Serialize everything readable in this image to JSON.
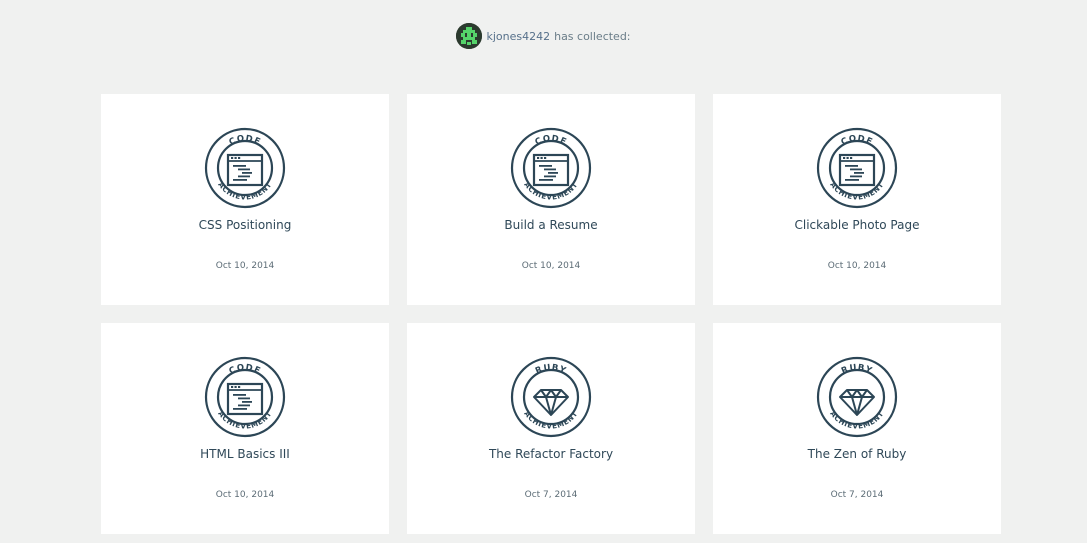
{
  "profile": {
    "username": "kjones4242",
    "collected_text": "has collected:"
  },
  "colors": {
    "badge": "#2c4656",
    "avatar_green": "#55d46a",
    "background": "#f0f1f0"
  },
  "achievements": [
    {
      "badge_top": "CODE",
      "badge_bottom": "ACHIEVEMENT",
      "icon": "code-window-icon",
      "title": "CSS Positioning",
      "date": "Oct 10, 2014"
    },
    {
      "badge_top": "CODE",
      "badge_bottom": "ACHIEVEMENT",
      "icon": "code-window-icon",
      "title": "Build a Resume",
      "date": "Oct 10, 2014"
    },
    {
      "badge_top": "CODE",
      "badge_bottom": "ACHIEVEMENT",
      "icon": "code-window-icon",
      "title": "Clickable Photo Page",
      "date": "Oct 10, 2014"
    },
    {
      "badge_top": "CODE",
      "badge_bottom": "ACHIEVEMENT",
      "icon": "code-window-icon",
      "title": "HTML Basics III",
      "date": "Oct 10, 2014"
    },
    {
      "badge_top": "RUBY",
      "badge_bottom": "ACHIEVEMENT",
      "icon": "ruby-gem-icon",
      "title": "The Refactor Factory",
      "date": "Oct 7, 2014"
    },
    {
      "badge_top": "RUBY",
      "badge_bottom": "ACHIEVEMENT",
      "icon": "ruby-gem-icon",
      "title": "The Zen of Ruby",
      "date": "Oct 7, 2014"
    }
  ]
}
